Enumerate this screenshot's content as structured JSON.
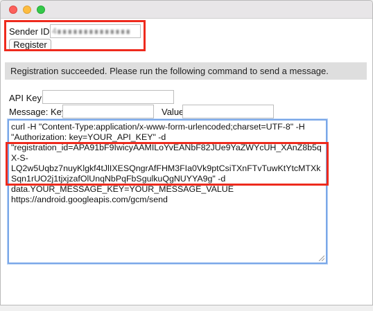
{
  "window": {
    "buttons": {
      "close": "close",
      "minimize": "minimize",
      "zoom": "zoom"
    }
  },
  "registration": {
    "sender_id_label": "Sender ID:",
    "sender_id_value": "4∎∎∎∎∎∎∎∎∎∎∎∎∎∎",
    "register_button": "Register"
  },
  "status": {
    "message": "Registration succeeded. Please run the following command to send a message."
  },
  "send_form": {
    "api_key_label": "API Key:",
    "api_key_value": "",
    "message_key_label": "Message: Key",
    "message_key_value": "",
    "value_label": "Value",
    "value_value": ""
  },
  "command_output": {
    "lines": [
      "curl -H \"Content-Type:application/x-www-form-urlencoded;charset=UTF-8\" -H",
      "\"Authorization: key=YOUR_API_KEY\" -d",
      "\"registration_id=APA91bF9IwicyAAMILoYvEANbF82JUe9YaZWYcUH_XAnZ8b5q",
      "X-S-",
      "LQ2w5Uqbz7nuyKlgkf4tJlIXESQngrAfFHM3FIa0Vk9ptCsiTXnFTvTuwKtYtcMTXk",
      "Sqn1rUO2j1tjxjzafOlUnqNbPqFbSgulkuQgNUYYA9g\" -d",
      "data.YOUR_MESSAGE_KEY=YOUR_MESSAGE_VALUE",
      "https://android.googleapis.com/gcm/send"
    ]
  },
  "colors": {
    "highlight": "#ee2a1d",
    "focus_ring": "#7aa7e8",
    "status_bg": "#dedede"
  }
}
